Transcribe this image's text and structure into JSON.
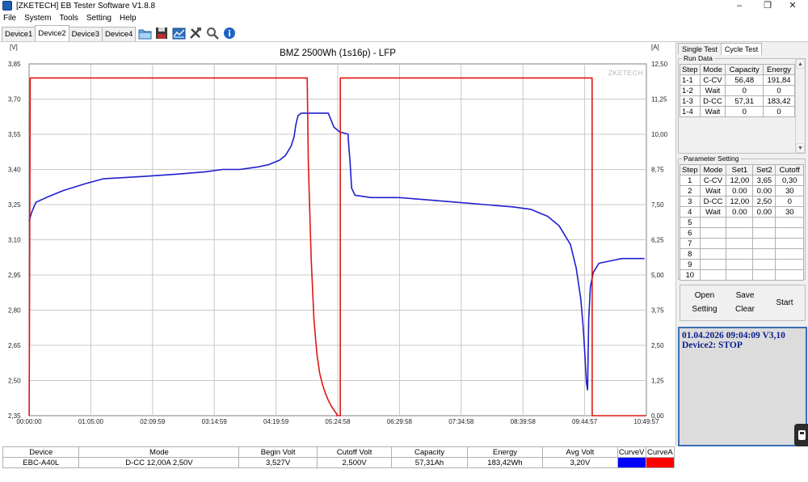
{
  "window": {
    "title": "[ZKETECH] EB Tester Software V1.8.8",
    "minimize": "–",
    "maximize": "❐",
    "close": "✕"
  },
  "menu": [
    "File",
    "System",
    "Tools",
    "Setting",
    "Help"
  ],
  "device_tabs": [
    "Device1",
    "Device2",
    "Device3",
    "Device4"
  ],
  "active_device_tab": 1,
  "toolbar_icons": [
    "folder-icon",
    "save-icon",
    "chart-icon",
    "tools-icon",
    "magnify-icon",
    "info-icon"
  ],
  "chart_data": {
    "type": "line",
    "title": "BMZ 2500Wh (1s16p) - LFP",
    "watermark": "ZKETECH",
    "ylabel_left": "[V]",
    "ylabel_right": "[A]",
    "ylim_left": [
      2.35,
      3.85
    ],
    "ylim_right": [
      0,
      12.5
    ],
    "yticks_left": [
      "3,85",
      "3,70",
      "3,55",
      "3,40",
      "3,25",
      "3,10",
      "2,95",
      "2,80",
      "2,65",
      "2,50",
      "2,35"
    ],
    "yticks_right": [
      "12,50",
      "11,25",
      "10,00",
      "8,75",
      "7,50",
      "6,25",
      "5,00",
      "3,75",
      "2,50",
      "1,25",
      "0,00"
    ],
    "xticks": [
      "00:00:00",
      "01:05:00",
      "02:09:59",
      "03:14:59",
      "04:19:59",
      "05:24:58",
      "06:29:58",
      "07:34:58",
      "08:39:58",
      "09:44:57",
      "10:49:57"
    ],
    "xlim_hours": [
      0,
      10.8325
    ],
    "grid": true,
    "series": [
      {
        "name": "CurveV",
        "axis": "left",
        "color": "#1f1fcf",
        "x_hours": [
          0.0,
          0.05,
          0.12,
          0.3,
          0.6,
          1.0,
          1.3,
          2.0,
          2.6,
          3.1,
          3.4,
          3.7,
          4.0,
          4.2,
          4.4,
          4.5,
          4.6,
          4.65,
          4.68,
          4.72,
          4.78,
          5.0,
          5.15,
          5.25,
          5.35,
          5.45,
          5.6,
          5.6,
          5.63,
          5.66,
          5.72,
          6.0,
          6.5,
          7.0,
          7.5,
          8.0,
          8.5,
          8.8,
          9.1,
          9.3,
          9.5,
          9.6,
          9.68,
          9.72,
          9.75,
          9.78,
          9.8,
          9.82,
          9.85,
          9.9,
          10.0,
          10.2,
          10.4,
          10.6,
          10.8
        ],
        "y": [
          3.18,
          3.22,
          3.26,
          3.28,
          3.31,
          3.34,
          3.36,
          3.37,
          3.38,
          3.39,
          3.4,
          3.4,
          3.41,
          3.42,
          3.44,
          3.46,
          3.5,
          3.54,
          3.59,
          3.63,
          3.64,
          3.64,
          3.64,
          3.64,
          3.58,
          3.56,
          3.55,
          3.53,
          3.44,
          3.32,
          3.29,
          3.28,
          3.28,
          3.27,
          3.26,
          3.25,
          3.24,
          3.23,
          3.2,
          3.16,
          3.08,
          2.98,
          2.85,
          2.74,
          2.62,
          2.49,
          2.46,
          2.76,
          2.9,
          2.96,
          3.0,
          3.01,
          3.02,
          3.02,
          3.02
        ]
      },
      {
        "name": "CurveA",
        "axis": "right",
        "color": "#e01515",
        "x_hours": [
          0.0,
          0.001,
          0.02,
          4.88,
          4.881,
          4.9,
          4.95,
          5.0,
          5.05,
          5.1,
          5.15,
          5.2,
          5.25,
          5.3,
          5.35,
          5.4,
          5.4,
          5.45,
          5.46,
          5.461,
          5.9,
          9.88,
          9.881,
          10.83
        ],
        "y": [
          0.0,
          0.0,
          12.0,
          12.0,
          12.0,
          9.0,
          5.6,
          3.4,
          2.2,
          1.5,
          1.1,
          0.8,
          0.55,
          0.35,
          0.2,
          0.05,
          0.0,
          0.0,
          0.0,
          12.0,
          12.0,
          12.0,
          0.0,
          0.0
        ]
      }
    ]
  },
  "right_panel": {
    "tabs": [
      "Single Test",
      "Cycle Test"
    ],
    "active_tab": 1,
    "run_data": {
      "label": "Run Data",
      "headers": [
        "Step",
        "Mode",
        "Capacity",
        "Energy"
      ],
      "rows": [
        [
          "1-1",
          "C-CV",
          "56,48",
          "191,84"
        ],
        [
          "1-2",
          "Wait",
          "0",
          "0"
        ],
        [
          "1-3",
          "D-CC",
          "57,31",
          "183,42"
        ],
        [
          "1-4",
          "Wait",
          "0",
          "0"
        ]
      ]
    },
    "parameter_setting": {
      "label": "Parameter Setting",
      "headers": [
        "Step",
        "Mode",
        "Set1",
        "Set2",
        "Cutoff"
      ],
      "rows": [
        [
          "1",
          "C-CV",
          "12,00",
          "3,65",
          "0,30"
        ],
        [
          "2",
          "Wait",
          "0.00",
          "0.00",
          "30"
        ],
        [
          "3",
          "D-CC",
          "12,00",
          "2,50",
          "0"
        ],
        [
          "4",
          "Wait",
          "0.00",
          "0.00",
          "30"
        ],
        [
          "5",
          "",
          "",
          "",
          ""
        ],
        [
          "6",
          "",
          "",
          "",
          ""
        ],
        [
          "7",
          "",
          "",
          "",
          ""
        ],
        [
          "8",
          "",
          "",
          "",
          ""
        ],
        [
          "9",
          "",
          "",
          "",
          ""
        ],
        [
          "10",
          "",
          "",
          "",
          ""
        ]
      ]
    },
    "buttons": {
      "open": "Open",
      "save": "Save",
      "setting": "Setting",
      "clear": "Clear",
      "start": "Start"
    },
    "status": {
      "line1": "01.04.2026 09:04:09  V3,10",
      "line2": "Device2: STOP"
    }
  },
  "summary": {
    "headers": [
      "Device",
      "Mode",
      "Begin Volt",
      "Cutoff Volt",
      "Capacity",
      "Energy",
      "Avg Volt",
      "CurveV",
      "CurveA"
    ],
    "values": [
      "EBC-A40L",
      "D-CC 12,00A  2,50V",
      "3,527V",
      "2,500V",
      "57,31Ah",
      "183,42Wh",
      "3,20V"
    ],
    "curve_colors": [
      "#0000ff",
      "#ff0000"
    ]
  }
}
